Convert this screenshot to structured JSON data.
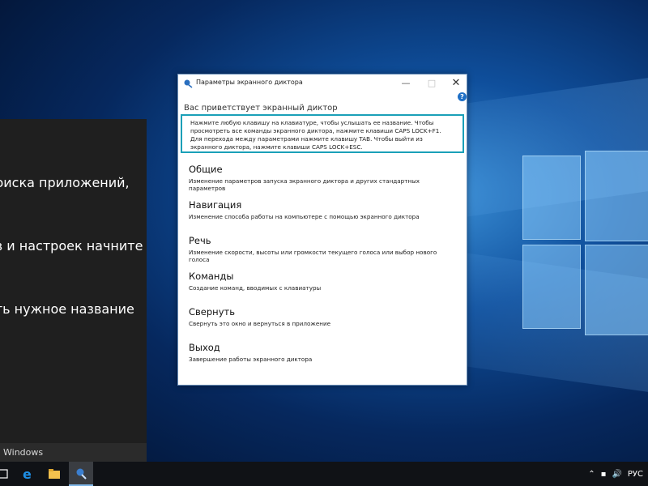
{
  "start_menu": {
    "lines": [
      "поиска приложений,",
      "ов и настроек начните",
      "ать нужное название"
    ],
    "bottom_label": "Windows"
  },
  "window": {
    "title": "Параметры экранного диктора",
    "welcome": "Вас приветствует экранный диктор",
    "info_text": "Нажмите любую клавишу на клавиатуре, чтобы услышать ее название. Чтобы просмотреть все команды экранного диктора, нажмите клавиши CAPS LOCK+F1. Для перехода между параметрами нажмите клавишу TAB. Чтобы выйти из экранного диктора, нажмите клавиши CAPS LOCK+ESC.",
    "help_label": "?",
    "sections": [
      {
        "title": "Общие",
        "desc": "Изменение параметров запуска экранного диктора и других стандартных параметров"
      },
      {
        "title": "Навигация",
        "desc": "Изменение способа работы на компьютере с помощью экранного диктора"
      },
      {
        "title": "Речь",
        "desc": "Изменение скорости, высоты или громкости текущего голоса или выбор нового голоса"
      },
      {
        "title": "Команды",
        "desc": "Создание команд, вводимых с клавиатуры"
      },
      {
        "title": "Свернуть",
        "desc": "Свернуть это окно и вернуться в приложение"
      },
      {
        "title": "Выход",
        "desc": "Завершение работы экранного диктора"
      }
    ]
  },
  "taskbar": {
    "items": [
      "task-view-icon",
      "edge-icon",
      "file-explorer-icon",
      "narrator-icon"
    ],
    "tray": {
      "language": "РУС"
    }
  }
}
